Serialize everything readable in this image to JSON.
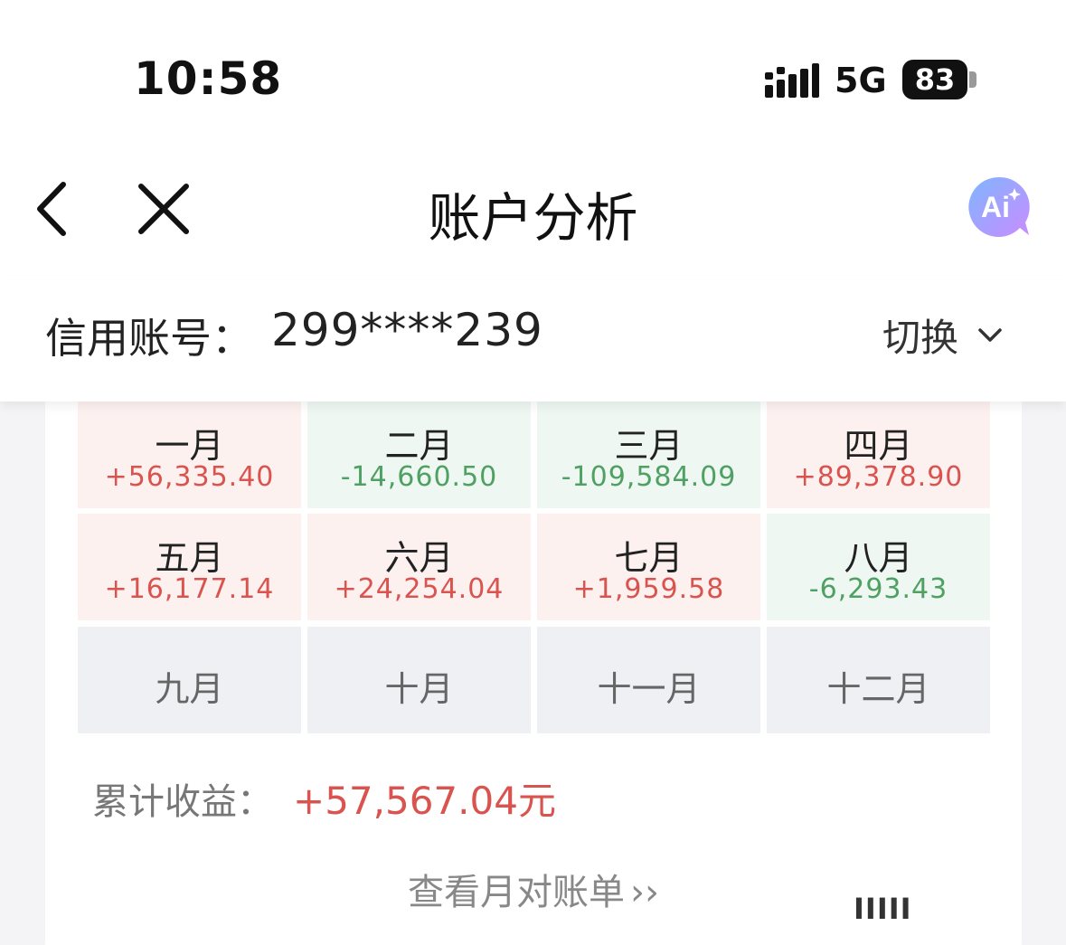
{
  "status_bar": {
    "time": "10:58",
    "network": "5G",
    "battery": "83"
  },
  "nav": {
    "title": "账户分析",
    "back_icon": "chevron-left-icon",
    "close_icon": "close-icon",
    "ai_icon": "ai-assistant-icon",
    "ai_label": "Ai"
  },
  "account": {
    "label": "信用账号：",
    "number": "299****239",
    "switch_label": "切换"
  },
  "months": [
    {
      "name": "一月",
      "value": "+56,335.40",
      "state": "pos"
    },
    {
      "name": "二月",
      "value": "-14,660.50",
      "state": "neg"
    },
    {
      "name": "三月",
      "value": "-109,584.09",
      "state": "neg"
    },
    {
      "name": "四月",
      "value": "+89,378.90",
      "state": "pos"
    },
    {
      "name": "五月",
      "value": "+16,177.14",
      "state": "pos"
    },
    {
      "name": "六月",
      "value": "+24,254.04",
      "state": "pos"
    },
    {
      "name": "七月",
      "value": "+1,959.58",
      "state": "pos"
    },
    {
      "name": "八月",
      "value": "-6,293.43",
      "state": "neg"
    },
    {
      "name": "九月",
      "value": "",
      "state": "empty"
    },
    {
      "name": "十月",
      "value": "",
      "state": "empty"
    },
    {
      "name": "十一月",
      "value": "",
      "state": "empty"
    },
    {
      "name": "十二月",
      "value": "",
      "state": "empty"
    }
  ],
  "summary": {
    "label": "累计收益：",
    "value": "+57,567.04元"
  },
  "statement_link": {
    "label": "查看月对账单",
    "arrows": "››"
  },
  "colors": {
    "positive": "#d9534f",
    "negative": "#4fa163",
    "positive_bg": "#fdf1f0",
    "negative_bg": "#eff7f2",
    "empty_bg": "#eff0f3"
  }
}
